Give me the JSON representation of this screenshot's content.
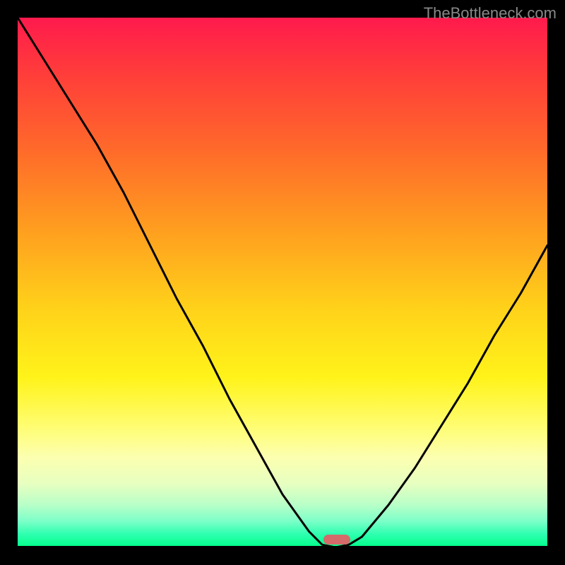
{
  "watermark": "TheBottleneck.com",
  "marker": {
    "x_frac": 0.602,
    "y_frac": 0.985
  },
  "chart_data": {
    "type": "line",
    "title": "",
    "xlabel": "",
    "ylabel": "",
    "xlim": [
      0,
      1
    ],
    "ylim": [
      0,
      1
    ],
    "series": [
      {
        "name": "bottleneck-curve",
        "x": [
          0.0,
          0.05,
          0.1,
          0.15,
          0.2,
          0.25,
          0.3,
          0.35,
          0.4,
          0.45,
          0.5,
          0.55,
          0.575,
          0.6,
          0.625,
          0.65,
          0.7,
          0.75,
          0.8,
          0.85,
          0.9,
          0.95,
          1.0
        ],
        "y": [
          1.0,
          0.92,
          0.84,
          0.76,
          0.67,
          0.57,
          0.47,
          0.38,
          0.28,
          0.19,
          0.1,
          0.03,
          0.005,
          0.0,
          0.005,
          0.02,
          0.08,
          0.15,
          0.23,
          0.31,
          0.4,
          0.48,
          0.57
        ]
      }
    ],
    "background_gradient": {
      "top": "#ff1a4d",
      "mid": "#fff31a",
      "bottom": "#00ff88"
    },
    "marker_point": {
      "x": 0.602,
      "y": 0.0,
      "color": "#d46a6a"
    }
  }
}
